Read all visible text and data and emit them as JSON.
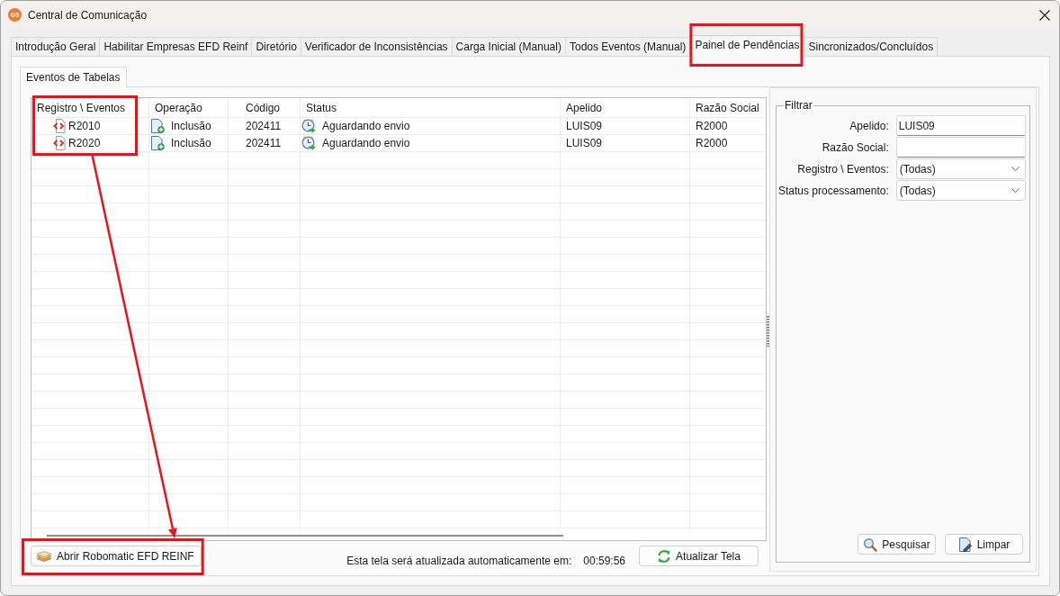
{
  "window": {
    "logo": "G5",
    "title": "Central de Comunicação"
  },
  "tabs": [
    {
      "label": "Introdução Geral",
      "selected": false,
      "highlighted": false
    },
    {
      "label": "Habilitar Empresas EFD Reinf",
      "selected": false,
      "highlighted": false
    },
    {
      "label": "Diretório",
      "selected": false,
      "highlighted": false
    },
    {
      "label": "Verificador de Inconsistências",
      "selected": false,
      "highlighted": false
    },
    {
      "label": "Carga Inicial (Manual)",
      "selected": false,
      "highlighted": false
    },
    {
      "label": "Todos Eventos (Manual)",
      "selected": false,
      "highlighted": false
    },
    {
      "label": "Painel de Pendências",
      "selected": true,
      "highlighted": true
    },
    {
      "label": "Sincronizados/Concluídos",
      "selected": false,
      "highlighted": false
    }
  ],
  "subtabs": [
    {
      "label": "Eventos de Tabelas",
      "selected": true
    }
  ],
  "grid": {
    "columns": [
      {
        "kind": "event",
        "label": "Registro \\ Eventos",
        "highlighted": true
      },
      {
        "kind": "operation",
        "label": "Operação",
        "highlighted": false
      },
      {
        "kind": "code",
        "label": "Código",
        "highlighted": false
      },
      {
        "kind": "status",
        "label": "Status",
        "highlighted": false
      },
      {
        "kind": "text",
        "label": "Apelido",
        "highlighted": false
      },
      {
        "kind": "text",
        "label": "Razão Social",
        "highlighted": false
      }
    ],
    "rows": [
      {
        "cells": [
          "R2010",
          "Inclusão",
          "202411",
          "Aguardando envio",
          "LUIS09",
          "R2000"
        ]
      },
      {
        "cells": [
          "R2020",
          "Inclusão",
          "202411",
          "Aguardando envio",
          "LUIS09",
          "R2000"
        ]
      }
    ]
  },
  "footer": {
    "robomatic_button": {
      "label": "Abrir Robomatic EFD REINF",
      "highlighted": true
    },
    "refresh_note": "Esta tela será atualizada automaticamente em:",
    "countdown": "00:59:56",
    "refresh_button": {
      "label": "Atualizar Tela"
    }
  },
  "filter": {
    "title": "Filtrar",
    "fields": [
      {
        "kind": "text",
        "label": "Apelido:",
        "value": "LUIS09"
      },
      {
        "kind": "text",
        "label": "Razão Social:"
      },
      {
        "kind": "select",
        "label": "Registro \\ Eventos:",
        "value": "(Todas)"
      },
      {
        "kind": "select",
        "label": "Status processamento:",
        "value": "(Todas)"
      }
    ],
    "buttons": [
      {
        "kind": "search",
        "label": "Pesquisar"
      },
      {
        "kind": "clear",
        "label": "Limpar"
      }
    ]
  },
  "annotation_arrow": true
}
